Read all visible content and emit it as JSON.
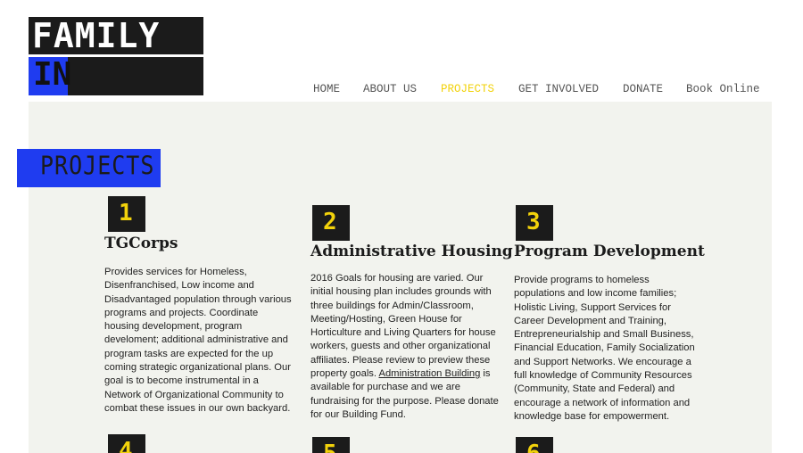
{
  "logo": {
    "line1": "FAMILY",
    "line2": "IN",
    "colors": {
      "dark": "#1b1b1b",
      "blue": "#1f3cf0"
    }
  },
  "nav": {
    "items": [
      {
        "label": "HOME"
      },
      {
        "label": "ABOUT US"
      },
      {
        "label": "PROJECTS",
        "active": true
      },
      {
        "label": "GET INVOLVED"
      },
      {
        "label": "DONATE"
      },
      {
        "label": "Book Online"
      }
    ],
    "active_color": "#f2d20b"
  },
  "section": {
    "title": "PROJECTS"
  },
  "projects": [
    {
      "number": "1",
      "title": "TGCorps",
      "text": "Provides services for Homeless, Disenfranchised, Low income and Disadvantaged population through various programs and projects. Coordinate housing development, program develoment; additional administrative and program tasks are expected for the up coming strategic organizational plans. Our goal is to become instrumental in a Network of Organizational Community to combat these issues in our own backyard."
    },
    {
      "number": "2",
      "title": "Administrative Housing",
      "text_before_link": "2016 Goals for housing are varied. Our initial housing plan includes grounds with three buildings for Admin/Classroom, Meeting/Hosting, Green House for Horticulture and Living Quarters for house workers, guests and other organizational affiliates. Please review to preview these property goals. ",
      "link": "Administration Building",
      "text_after_link": " is available for purchase and we are fundraising for the purpose. Please donate for our Building Fund."
    },
    {
      "number": "3",
      "title": "Program Development",
      "text": "Provide programs to homeless populations and low income families; Holistic Living, Support Services for Career Development and Training, Entrepreneurialship and Small Business, Financial Education, Family Socialization and Support Networks. We encourage a full knowledge of Community Resources (Community, State and Federal) and encourage a network of information and knowledge base for empowerment."
    },
    {
      "number": "4"
    },
    {
      "number": "5"
    },
    {
      "number": "6"
    }
  ]
}
